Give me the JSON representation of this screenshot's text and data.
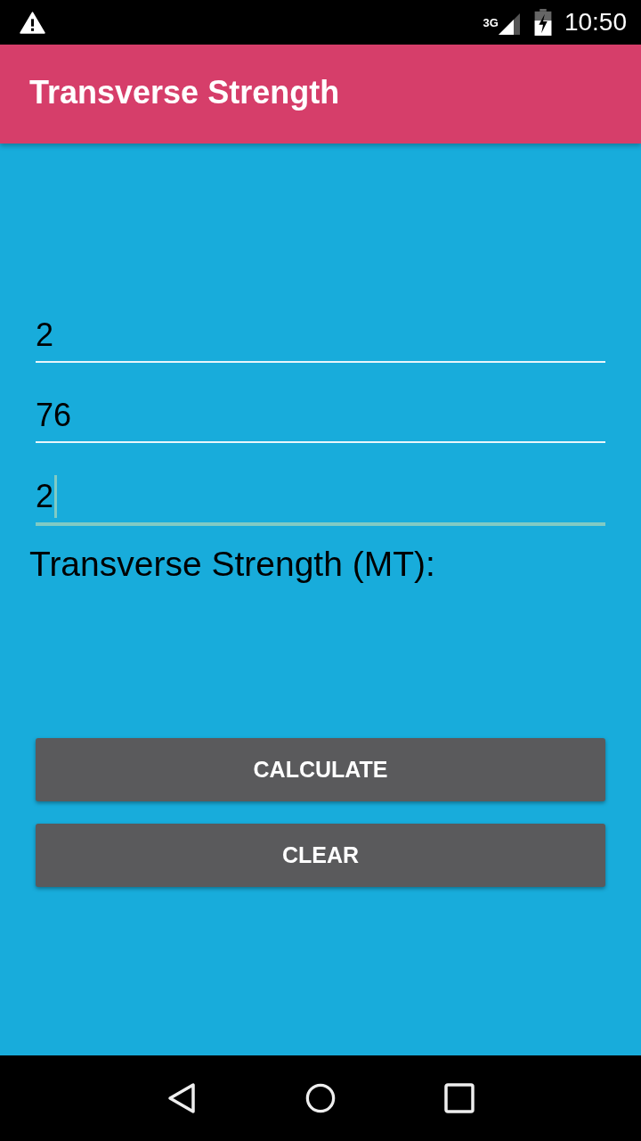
{
  "status_bar": {
    "network": "3G",
    "time": "10:50"
  },
  "app_bar": {
    "title": "Transverse Strength"
  },
  "fields": [
    {
      "value": "2",
      "focused": false
    },
    {
      "value": "76",
      "focused": false
    },
    {
      "value": "2",
      "focused": true
    }
  ],
  "result_label": "Transverse Strength (MT):",
  "buttons": [
    {
      "label": "CALCULATE"
    },
    {
      "label": "CLEAR"
    }
  ]
}
